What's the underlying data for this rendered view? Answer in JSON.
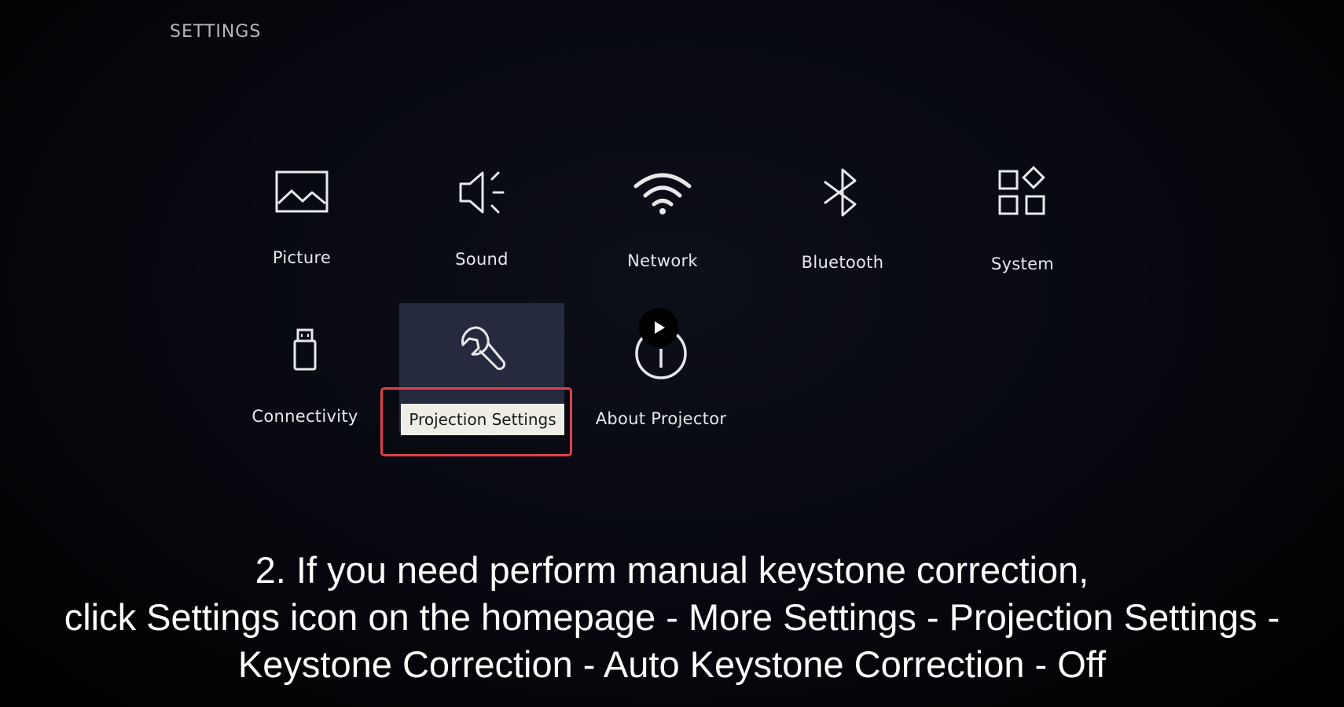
{
  "screen": {
    "title": "SETTINGS"
  },
  "menu": {
    "items": [
      {
        "label": "Picture",
        "icon": "picture-icon"
      },
      {
        "label": "Sound",
        "icon": "speaker-icon"
      },
      {
        "label": "Network",
        "icon": "wifi-icon"
      },
      {
        "label": "Bluetooth",
        "icon": "bluetooth-icon"
      },
      {
        "label": "System",
        "icon": "apps-grid-icon"
      },
      {
        "label": "Connectivity",
        "icon": "usb-drive-icon"
      },
      {
        "label": "Projection Settings",
        "icon": "wrench-icon",
        "focused": true
      },
      {
        "label": "About Projector",
        "icon": "info-icon"
      }
    ]
  },
  "video": {
    "play_icon": "play-icon"
  },
  "caption": {
    "line1": "2. If you need perform manual keystone correction,",
    "line2": "click Settings icon on the homepage - More Settings - Projection Settings -",
    "line3": "Keystone Correction - Auto Keystone Correction - Off"
  },
  "colors": {
    "highlight_border": "#e0404a",
    "focus_background": "#262a3f",
    "focus_label_background": "#efeee6"
  }
}
